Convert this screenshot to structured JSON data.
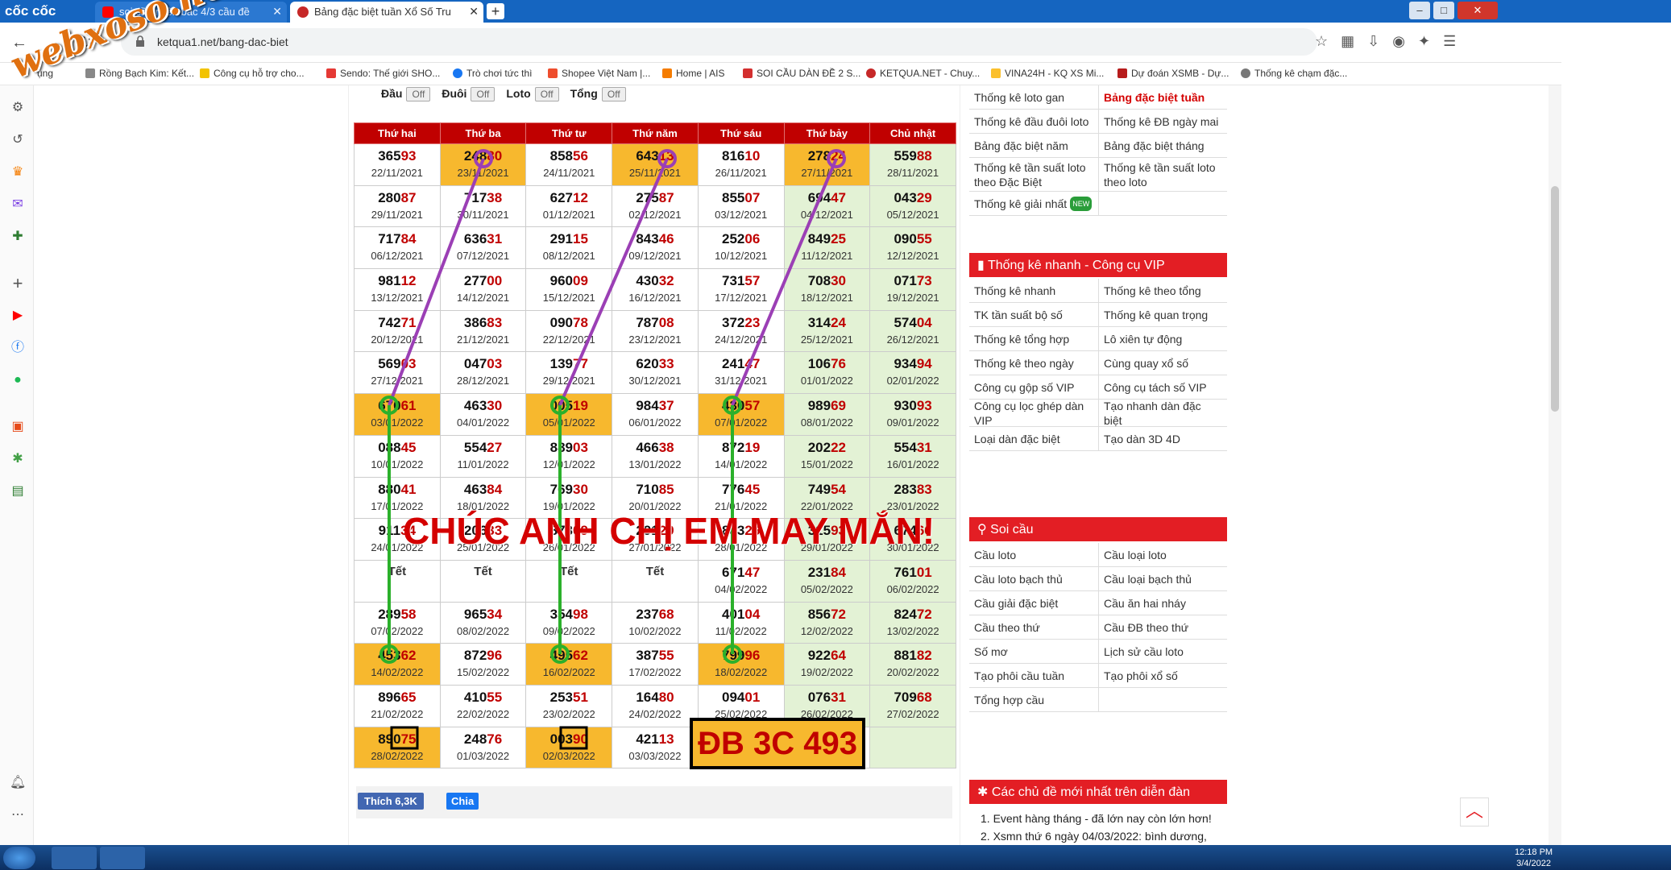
{
  "browser": {
    "logo": "cốc cốc",
    "tabs": [
      {
        "title": "soi cầu miền bắc 4/3 cầu đề"
      },
      {
        "title": "Bảng đặc biệt tuần Xổ Số Tru"
      }
    ],
    "url": "ketqua1.net/bang-dac-biet",
    "watermark": "webxoso.net"
  },
  "bookmarks": [
    {
      "label": "ụng"
    },
    {
      "label": "Rồng Bạch Kim: Kết..."
    },
    {
      "label": "Công cụ hỗ trợ cho..."
    },
    {
      "label": "Sendo: Thế giới SHO..."
    },
    {
      "label": "Trò chơi tức thì"
    },
    {
      "label": "Shopee Việt Nam |..."
    },
    {
      "label": "Home | AIS"
    },
    {
      "label": "SOI CẦU DÀN ĐỀ 2 S..."
    },
    {
      "label": "KETQUA.NET - Chuy..."
    },
    {
      "label": "VINA24H - KQ XS Mi..."
    },
    {
      "label": "Dự đoán XSMB - Dự..."
    },
    {
      "label": "Thống kê chạm đặc..."
    }
  ],
  "filters": {
    "items": [
      "Đầu",
      "Đuôi",
      "Loto",
      "Tổng"
    ],
    "state": "Off"
  },
  "table": {
    "headers": [
      "Thứ hai",
      "Thứ ba",
      "Thứ tư",
      "Thứ năm",
      "Thứ sáu",
      "Thứ bảy",
      "Chủ nhật"
    ],
    "rows": [
      [
        [
          "36593",
          "22/11/2021",
          ""
        ],
        [
          "24880",
          "23/11/2021",
          "o"
        ],
        [
          "85856",
          "24/11/2021",
          ""
        ],
        [
          "64313",
          "25/11/2021",
          "o"
        ],
        [
          "81610",
          "26/11/2021",
          ""
        ],
        [
          "27824",
          "27/11/2021",
          "o"
        ],
        [
          "55988",
          "28/11/2021",
          "g"
        ]
      ],
      [
        [
          "28087",
          "29/11/2021",
          ""
        ],
        [
          "71738",
          "30/11/2021",
          ""
        ],
        [
          "62712",
          "01/12/2021",
          ""
        ],
        [
          "27587",
          "02/12/2021",
          ""
        ],
        [
          "85507",
          "03/12/2021",
          ""
        ],
        [
          "69447",
          "04/12/2021",
          "g"
        ],
        [
          "04329",
          "05/12/2021",
          "g"
        ]
      ],
      [
        [
          "71784",
          "06/12/2021",
          ""
        ],
        [
          "63631",
          "07/12/2021",
          ""
        ],
        [
          "29115",
          "08/12/2021",
          ""
        ],
        [
          "84346",
          "09/12/2021",
          ""
        ],
        [
          "25206",
          "10/12/2021",
          ""
        ],
        [
          "84925",
          "11/12/2021",
          "g"
        ],
        [
          "09055",
          "12/12/2021",
          "g"
        ]
      ],
      [
        [
          "98112",
          "13/12/2021",
          ""
        ],
        [
          "27700",
          "14/12/2021",
          ""
        ],
        [
          "96009",
          "15/12/2021",
          ""
        ],
        [
          "43032",
          "16/12/2021",
          ""
        ],
        [
          "73157",
          "17/12/2021",
          ""
        ],
        [
          "70830",
          "18/12/2021",
          "g"
        ],
        [
          "07173",
          "19/12/2021",
          "g"
        ]
      ],
      [
        [
          "74271",
          "20/12/2021",
          ""
        ],
        [
          "38683",
          "21/12/2021",
          ""
        ],
        [
          "09078",
          "22/12/2021",
          ""
        ],
        [
          "78708",
          "23/12/2021",
          ""
        ],
        [
          "37223",
          "24/12/2021",
          ""
        ],
        [
          "31424",
          "25/12/2021",
          "g"
        ],
        [
          "57404",
          "26/12/2021",
          "g"
        ]
      ],
      [
        [
          "56903",
          "27/12/2021",
          ""
        ],
        [
          "04703",
          "28/12/2021",
          ""
        ],
        [
          "13977",
          "29/12/2021",
          ""
        ],
        [
          "62033",
          "30/12/2021",
          ""
        ],
        [
          "24147",
          "31/12/2021",
          ""
        ],
        [
          "10676",
          "01/01/2022",
          "g"
        ],
        [
          "93494",
          "02/01/2022",
          "g"
        ]
      ],
      [
        [
          "67061",
          "03/01/2022",
          "o"
        ],
        [
          "46330",
          "04/01/2022",
          ""
        ],
        [
          "00519",
          "05/01/2022",
          "o"
        ],
        [
          "98437",
          "06/01/2022",
          ""
        ],
        [
          "43057",
          "07/01/2022",
          "o"
        ],
        [
          "98969",
          "08/01/2022",
          "g"
        ],
        [
          "93093",
          "09/01/2022",
          "g"
        ]
      ],
      [
        [
          "08845",
          "10/01/2022",
          ""
        ],
        [
          "55427",
          "11/01/2022",
          ""
        ],
        [
          "88903",
          "12/01/2022",
          ""
        ],
        [
          "46638",
          "13/01/2022",
          ""
        ],
        [
          "87219",
          "14/01/2022",
          ""
        ],
        [
          "20222",
          "15/01/2022",
          "g"
        ],
        [
          "55431",
          "16/01/2022",
          "g"
        ]
      ],
      [
        [
          "88041",
          "17/01/2022",
          ""
        ],
        [
          "46384",
          "18/01/2022",
          ""
        ],
        [
          "76930",
          "19/01/2022",
          ""
        ],
        [
          "71085",
          "20/01/2022",
          ""
        ],
        [
          "77645",
          "21/01/2022",
          ""
        ],
        [
          "74954",
          "22/01/2022",
          "g"
        ],
        [
          "28383",
          "23/01/2022",
          "g"
        ]
      ],
      [
        [
          "91134",
          "24/01/2022",
          ""
        ],
        [
          "20633",
          "25/01/2022",
          ""
        ],
        [
          "87309",
          "26/01/2022",
          ""
        ],
        [
          "29129",
          "27/01/2022",
          ""
        ],
        [
          "88326",
          "28/01/2022",
          ""
        ],
        [
          "31593",
          "29/01/2022",
          "g"
        ],
        [
          "67466",
          "30/01/2022",
          "g"
        ]
      ],
      [
        [
          "Tết",
          "",
          ""
        ],
        [
          "Tết",
          "",
          ""
        ],
        [
          "Tết",
          "",
          ""
        ],
        [
          "Tết",
          "",
          ""
        ],
        [
          "67147",
          "04/02/2022",
          ""
        ],
        [
          "23184",
          "05/02/2022",
          "g"
        ],
        [
          "76101",
          "06/02/2022",
          "g"
        ]
      ],
      [
        [
          "28958",
          "07/02/2022",
          ""
        ],
        [
          "96534",
          "08/02/2022",
          ""
        ],
        [
          "35498",
          "09/02/2022",
          ""
        ],
        [
          "23768",
          "10/02/2022",
          ""
        ],
        [
          "40104",
          "11/02/2022",
          ""
        ],
        [
          "85672",
          "12/02/2022",
          "g"
        ],
        [
          "82472",
          "13/02/2022",
          "g"
        ]
      ],
      [
        [
          "45362",
          "14/02/2022",
          "o"
        ],
        [
          "87296",
          "15/02/2022",
          ""
        ],
        [
          "49562",
          "16/02/2022",
          "o"
        ],
        [
          "38755",
          "17/02/2022",
          ""
        ],
        [
          "79996",
          "18/02/2022",
          "o"
        ],
        [
          "92264",
          "19/02/2022",
          "g"
        ],
        [
          "88182",
          "20/02/2022",
          "g"
        ]
      ],
      [
        [
          "89665",
          "21/02/2022",
          ""
        ],
        [
          "41055",
          "22/02/2022",
          ""
        ],
        [
          "25351",
          "23/02/2022",
          ""
        ],
        [
          "16480",
          "24/02/2022",
          ""
        ],
        [
          "09401",
          "25/02/2022",
          ""
        ],
        [
          "07631",
          "26/02/2022",
          "g"
        ],
        [
          "70968",
          "27/02/2022",
          "g"
        ]
      ],
      [
        [
          "89075",
          "28/02/2022",
          "o"
        ],
        [
          "24876",
          "01/03/2022",
          ""
        ],
        [
          "00390",
          "02/03/2022",
          "o"
        ],
        [
          "42113",
          "03/03/2022",
          ""
        ],
        [
          "",
          "",
          ""
        ],
        [
          "",
          "",
          ""
        ],
        [
          "",
          "",
          "g"
        ]
      ]
    ]
  },
  "overlay": {
    "banner": "CHÚC ANH CHỊ EM MAY MẮN!",
    "prediction": "ĐB 3C 493"
  },
  "share": {
    "like": "Thích 6,3K",
    "share": "Chia"
  },
  "right_panel": {
    "top_links": [
      [
        "Thống kê loto gan",
        "Bảng đặc biệt tuần"
      ],
      [
        "Thống kê đầu đuôi loto",
        "Thống kê ĐB ngày mai"
      ],
      [
        "Bảng đặc biệt năm",
        "Bảng đặc biệt tháng"
      ],
      [
        "Thống kê tần suất loto theo Đặc Biệt",
        "Thống kê tần suất loto theo loto"
      ],
      [
        "Thống kê giải nhất",
        ""
      ]
    ],
    "new_badge": "NEW",
    "vip_header": "Thống kê nhanh - Công cụ VIP",
    "vip_links": [
      [
        "Thống kê nhanh",
        "Thống kê theo tổng"
      ],
      [
        "TK tần suất bộ số",
        "Thống kê quan trọng"
      ],
      [
        "Thống kê tổng hợp",
        "Lô xiên tự động"
      ],
      [
        "Thống kê theo ngày",
        "Cùng quay xổ số"
      ],
      [
        "Công cụ gộp số VIP",
        "Công cụ tách số VIP"
      ],
      [
        "Công cụ lọc ghép dàn VIP",
        "Tạo nhanh dàn đặc biệt"
      ],
      [
        "Loại dàn đặc biệt",
        "Tạo dàn 3D 4D"
      ]
    ],
    "soi_header": "Soi cầu",
    "soi_links": [
      [
        "Cầu loto",
        "Cầu loại loto"
      ],
      [
        "Cầu loto bạch thủ",
        "Cầu loại bạch thủ"
      ],
      [
        "Cầu giải đặc biệt",
        "Cầu ăn hai nháy"
      ],
      [
        "Cầu theo thứ",
        "Cầu ĐB theo thứ"
      ],
      [
        "Số mơ",
        "Lịch sử cầu loto"
      ],
      [
        "Tạo phôi cầu tuần",
        "Tạo phôi xổ số"
      ],
      [
        "Tổng hợp cầu",
        ""
      ]
    ],
    "forum_header": "Các chủ đề mới nhất trên diễn đàn",
    "forum_items": [
      "1. Event hàng tháng - đã lớn nay còn lớn hơn!",
      "2. Xsmn thứ 6 ngày 04/03/2022: bình dương,"
    ]
  },
  "taskbar": {
    "time": "12:18 PM",
    "date": "3/4/2022"
  },
  "colors": {
    "header_red": "#c00000",
    "orange": "#f7b82e",
    "green_cell": "#e3f2d5",
    "purple_line": "#9b3fb5",
    "green_line": "#2bb02b"
  }
}
